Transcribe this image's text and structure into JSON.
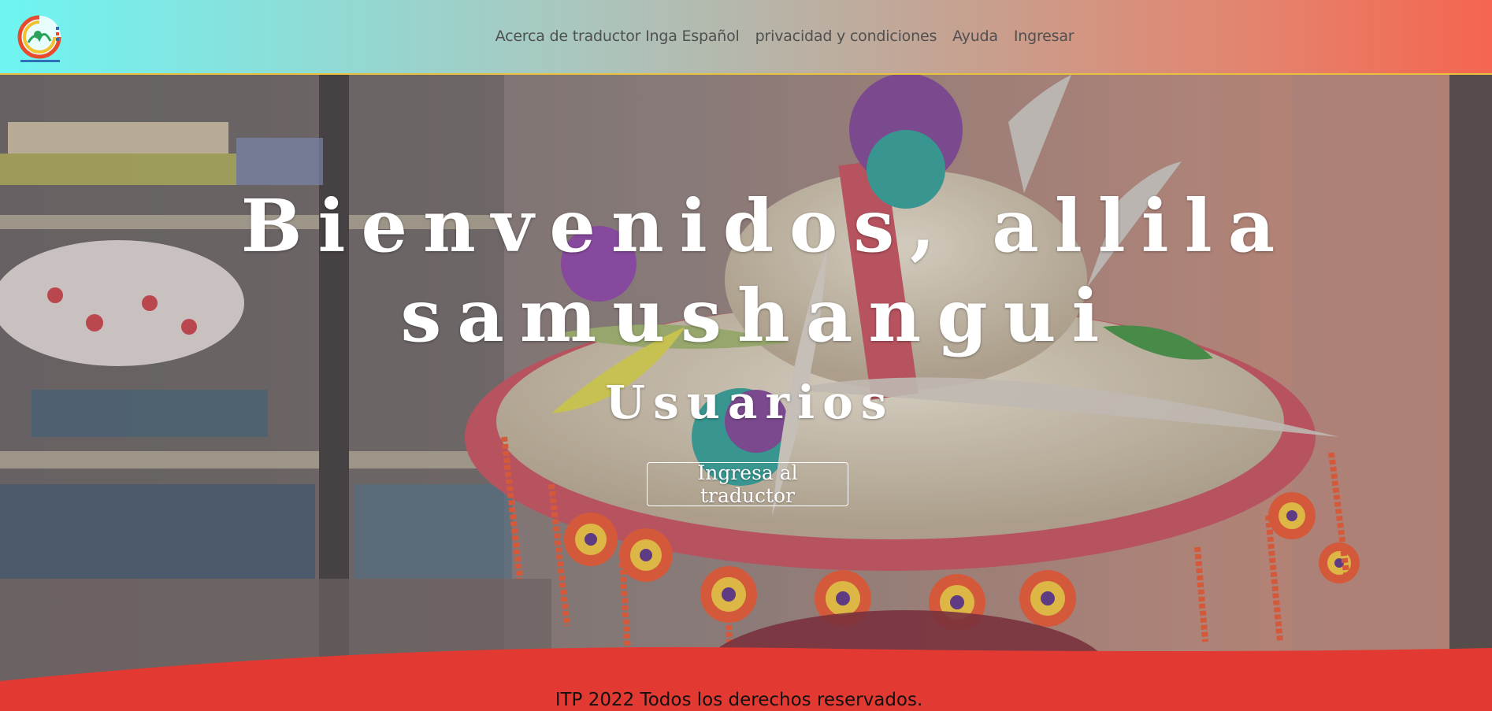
{
  "header": {
    "logo_icon": "institution-logo-icon",
    "logo_colors": [
      "#e84a2e",
      "#f2c12e",
      "#29a35b",
      "#2e6fb8"
    ],
    "nav": [
      {
        "label": "Acerca de traductor Inga Español"
      },
      {
        "label": "privacidad y condiciones"
      },
      {
        "label": "Ayuda"
      },
      {
        "label": "Ingresar"
      }
    ]
  },
  "hero": {
    "title_line1": "Bienvenidos, allila",
    "title_line2": "samushangui",
    "subtitle": "Usuarios",
    "cta_label": "Ingresa al traductor"
  },
  "footer": {
    "text": "ITP 2022 Todos los derechos reservados.",
    "color": "#e23a32"
  }
}
